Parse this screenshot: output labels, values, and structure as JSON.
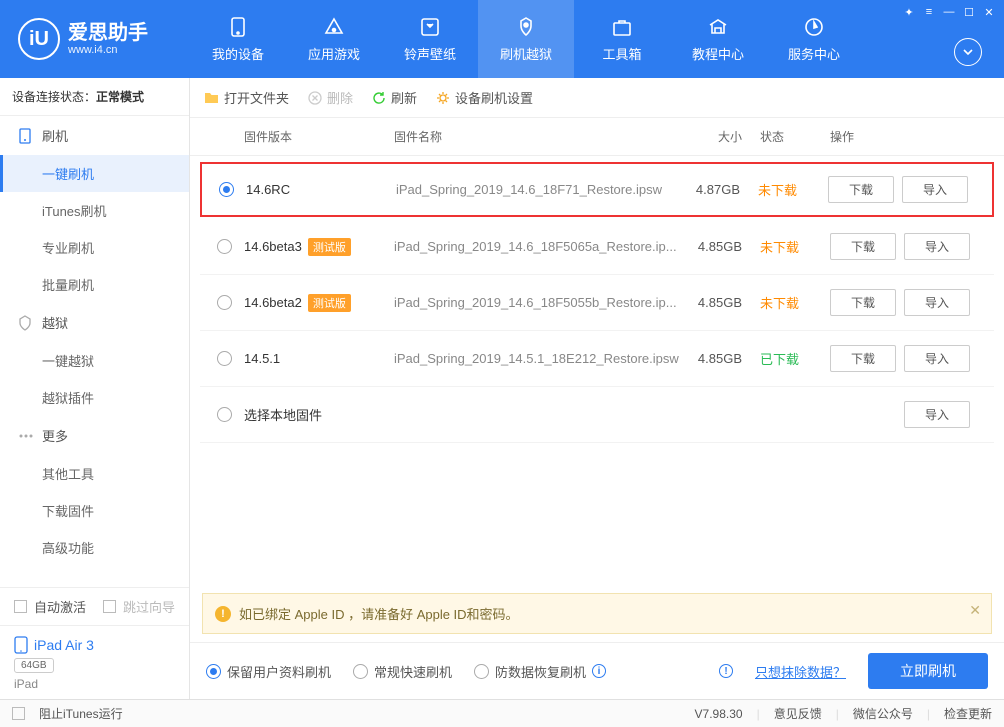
{
  "app": {
    "name": "爱思助手",
    "url": "www.i4.cn"
  },
  "nav": {
    "items": [
      {
        "label": "我的设备"
      },
      {
        "label": "应用游戏"
      },
      {
        "label": "铃声壁纸"
      },
      {
        "label": "刷机越狱"
      },
      {
        "label": "工具箱"
      },
      {
        "label": "教程中心"
      },
      {
        "label": "服务中心"
      }
    ]
  },
  "sidebar": {
    "status_prefix": "设备连接状态：",
    "status_value": "正常模式",
    "groups": [
      {
        "label": "刷机",
        "subs": [
          "一键刷机",
          "iTunes刷机",
          "专业刷机",
          "批量刷机"
        ]
      },
      {
        "label": "越狱",
        "subs": [
          "一键越狱",
          "越狱插件"
        ]
      },
      {
        "label": "更多",
        "subs": [
          "其他工具",
          "下载固件",
          "高级功能"
        ]
      }
    ],
    "auto_activate": "自动激活",
    "skip_guide": "跳过向导",
    "device_name": "iPad Air 3",
    "device_tag": "64GB",
    "device_model": "iPad"
  },
  "toolbar": {
    "open_folder": "打开文件夹",
    "delete": "删除",
    "refresh": "刷新",
    "settings": "设备刷机设置"
  },
  "table": {
    "h_version": "固件版本",
    "h_name": "固件名称",
    "h_size": "大小",
    "h_status": "状态",
    "h_ops": "操作",
    "rows": [
      {
        "version": "14.6RC",
        "beta": false,
        "name": "iPad_Spring_2019_14.6_18F71_Restore.ipsw",
        "size": "4.87GB",
        "status": "未下载",
        "status_cls": "not",
        "selected": true,
        "highlight": true
      },
      {
        "version": "14.6beta3",
        "beta": true,
        "name": "iPad_Spring_2019_14.6_18F5065a_Restore.ip...",
        "size": "4.85GB",
        "status": "未下载",
        "status_cls": "not"
      },
      {
        "version": "14.6beta2",
        "beta": true,
        "name": "iPad_Spring_2019_14.6_18F5055b_Restore.ip...",
        "size": "4.85GB",
        "status": "未下载",
        "status_cls": "not"
      },
      {
        "version": "14.5.1",
        "beta": false,
        "name": "iPad_Spring_2019_14.5.1_18E212_Restore.ipsw",
        "size": "4.85GB",
        "status": "已下载",
        "status_cls": "done"
      }
    ],
    "local_row": "选择本地固件",
    "beta_badge": "测试版",
    "btn_download": "下载",
    "btn_import": "导入"
  },
  "alert": {
    "text": "如已绑定 Apple ID ，请准备好 Apple ID和密码。"
  },
  "options": {
    "o1": "保留用户资料刷机",
    "o2": "常规快速刷机",
    "o3": "防数据恢复刷机",
    "erase_link": "只想抹除数据？",
    "flash_btn": "立即刷机"
  },
  "footer": {
    "block_itunes": "阻止iTunes运行",
    "version": "V7.98.30",
    "feedback": "意见反馈",
    "wechat": "微信公众号",
    "update": "检查更新"
  }
}
